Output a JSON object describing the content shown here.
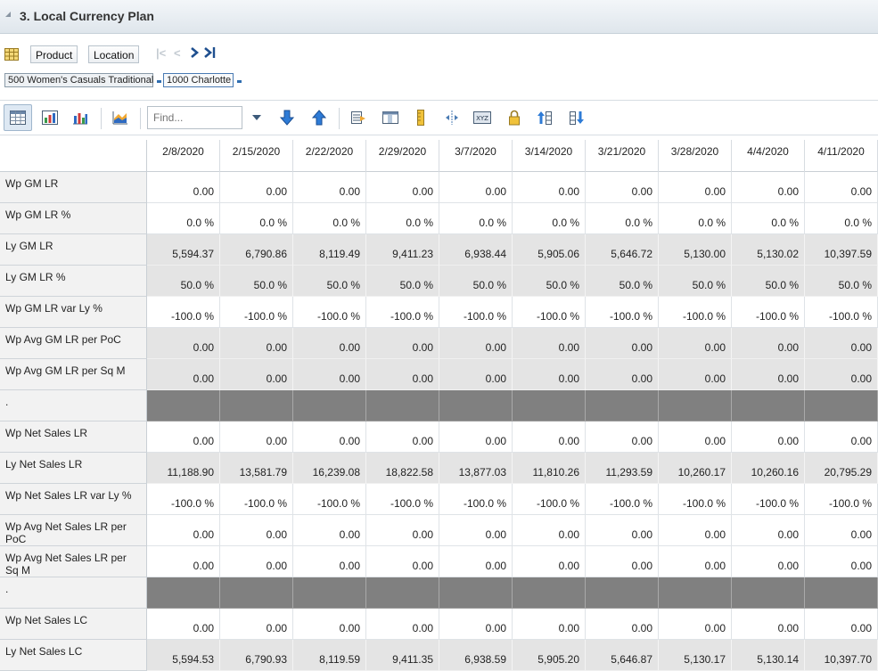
{
  "window": {
    "title": "3. Local Currency Plan"
  },
  "dimension_bar": {
    "product_label": "Product",
    "location_label": "Location",
    "product_crumb": "500 Women's Casuals Traditional",
    "location_crumb": "1000 Charlotte"
  },
  "toolbar": {
    "find_placeholder": "Find..."
  },
  "icons": [
    "grid-view-icon",
    "chart-grid-icon",
    "chart-icon",
    "area-chart-icon",
    "find-dropdown-icon",
    "arrow-down-icon",
    "arrow-up-icon",
    "export-icon",
    "show-columns-icon",
    "ruler-icon",
    "split-icon",
    "xyz-icon",
    "lock-icon",
    "sort-ascending-icon",
    "sort-descending-icon"
  ],
  "colors": {
    "shaded_row": "#e4e4e4",
    "separator_row": "#808080",
    "nav_enabled": "#1f4f8f"
  },
  "grid": {
    "columns": [
      "2/8/2020",
      "2/15/2020",
      "2/22/2020",
      "2/29/2020",
      "3/7/2020",
      "3/14/2020",
      "3/21/2020",
      "3/28/2020",
      "4/4/2020",
      "4/11/2020"
    ],
    "rows": [
      {
        "label": "Wp GM LR",
        "shade": "white",
        "values": [
          "0.00",
          "0.00",
          "0.00",
          "0.00",
          "0.00",
          "0.00",
          "0.00",
          "0.00",
          "0.00",
          "0.00"
        ]
      },
      {
        "label": "Wp GM LR %",
        "shade": "white",
        "values": [
          "0.0 %",
          "0.0 %",
          "0.0 %",
          "0.0 %",
          "0.0 %",
          "0.0 %",
          "0.0 %",
          "0.0 %",
          "0.0 %",
          "0.0 %"
        ]
      },
      {
        "label": "Ly GM LR",
        "shade": "gray",
        "values": [
          "5,594.37",
          "6,790.86",
          "8,119.49",
          "9,411.23",
          "6,938.44",
          "5,905.06",
          "5,646.72",
          "5,130.00",
          "5,130.02",
          "10,397.59"
        ]
      },
      {
        "label": "Ly GM LR %",
        "shade": "gray",
        "values": [
          "50.0 %",
          "50.0 %",
          "50.0 %",
          "50.0 %",
          "50.0 %",
          "50.0 %",
          "50.0 %",
          "50.0 %",
          "50.0 %",
          "50.0 %"
        ]
      },
      {
        "label": "Wp GM LR var Ly %",
        "shade": "white",
        "values": [
          "-100.0 %",
          "-100.0 %",
          "-100.0 %",
          "-100.0 %",
          "-100.0 %",
          "-100.0 %",
          "-100.0 %",
          "-100.0 %",
          "-100.0 %",
          "-100.0 %"
        ]
      },
      {
        "label": "Wp Avg GM LR per PoC",
        "shade": "gray",
        "values": [
          "0.00",
          "0.00",
          "0.00",
          "0.00",
          "0.00",
          "0.00",
          "0.00",
          "0.00",
          "0.00",
          "0.00"
        ]
      },
      {
        "label": "Wp Avg GM LR per Sq M",
        "shade": "gray",
        "values": [
          "0.00",
          "0.00",
          "0.00",
          "0.00",
          "0.00",
          "0.00",
          "0.00",
          "0.00",
          "0.00",
          "0.00"
        ]
      },
      {
        "label": ".",
        "shade": "dark",
        "values": [
          "",
          "",
          "",
          "",
          "",
          "",
          "",
          "",
          "",
          ""
        ]
      },
      {
        "label": "Wp Net Sales LR",
        "shade": "white",
        "values": [
          "0.00",
          "0.00",
          "0.00",
          "0.00",
          "0.00",
          "0.00",
          "0.00",
          "0.00",
          "0.00",
          "0.00"
        ]
      },
      {
        "label": "Ly Net Sales LR",
        "shade": "gray",
        "values": [
          "11,188.90",
          "13,581.79",
          "16,239.08",
          "18,822.58",
          "13,877.03",
          "11,810.26",
          "11,293.59",
          "10,260.17",
          "10,260.16",
          "20,795.29"
        ]
      },
      {
        "label": "Wp Net Sales LR var Ly %",
        "shade": "white",
        "values": [
          "-100.0 %",
          "-100.0 %",
          "-100.0 %",
          "-100.0 %",
          "-100.0 %",
          "-100.0 %",
          "-100.0 %",
          "-100.0 %",
          "-100.0 %",
          "-100.0 %"
        ]
      },
      {
        "label": "Wp Avg Net Sales LR per PoC",
        "shade": "white",
        "values": [
          "0.00",
          "0.00",
          "0.00",
          "0.00",
          "0.00",
          "0.00",
          "0.00",
          "0.00",
          "0.00",
          "0.00"
        ]
      },
      {
        "label": "Wp Avg Net Sales LR per Sq M",
        "shade": "white",
        "values": [
          "0.00",
          "0.00",
          "0.00",
          "0.00",
          "0.00",
          "0.00",
          "0.00",
          "0.00",
          "0.00",
          "0.00"
        ]
      },
      {
        "label": ".",
        "shade": "dark",
        "values": [
          "",
          "",
          "",
          "",
          "",
          "",
          "",
          "",
          "",
          ""
        ]
      },
      {
        "label": "Wp Net Sales LC",
        "shade": "white",
        "values": [
          "0.00",
          "0.00",
          "0.00",
          "0.00",
          "0.00",
          "0.00",
          "0.00",
          "0.00",
          "0.00",
          "0.00"
        ]
      },
      {
        "label": "Ly Net Sales LC",
        "shade": "gray",
        "values": [
          "5,594.53",
          "6,790.93",
          "8,119.59",
          "9,411.35",
          "6,938.59",
          "5,905.20",
          "5,646.87",
          "5,130.17",
          "5,130.14",
          "10,397.70"
        ]
      }
    ]
  }
}
